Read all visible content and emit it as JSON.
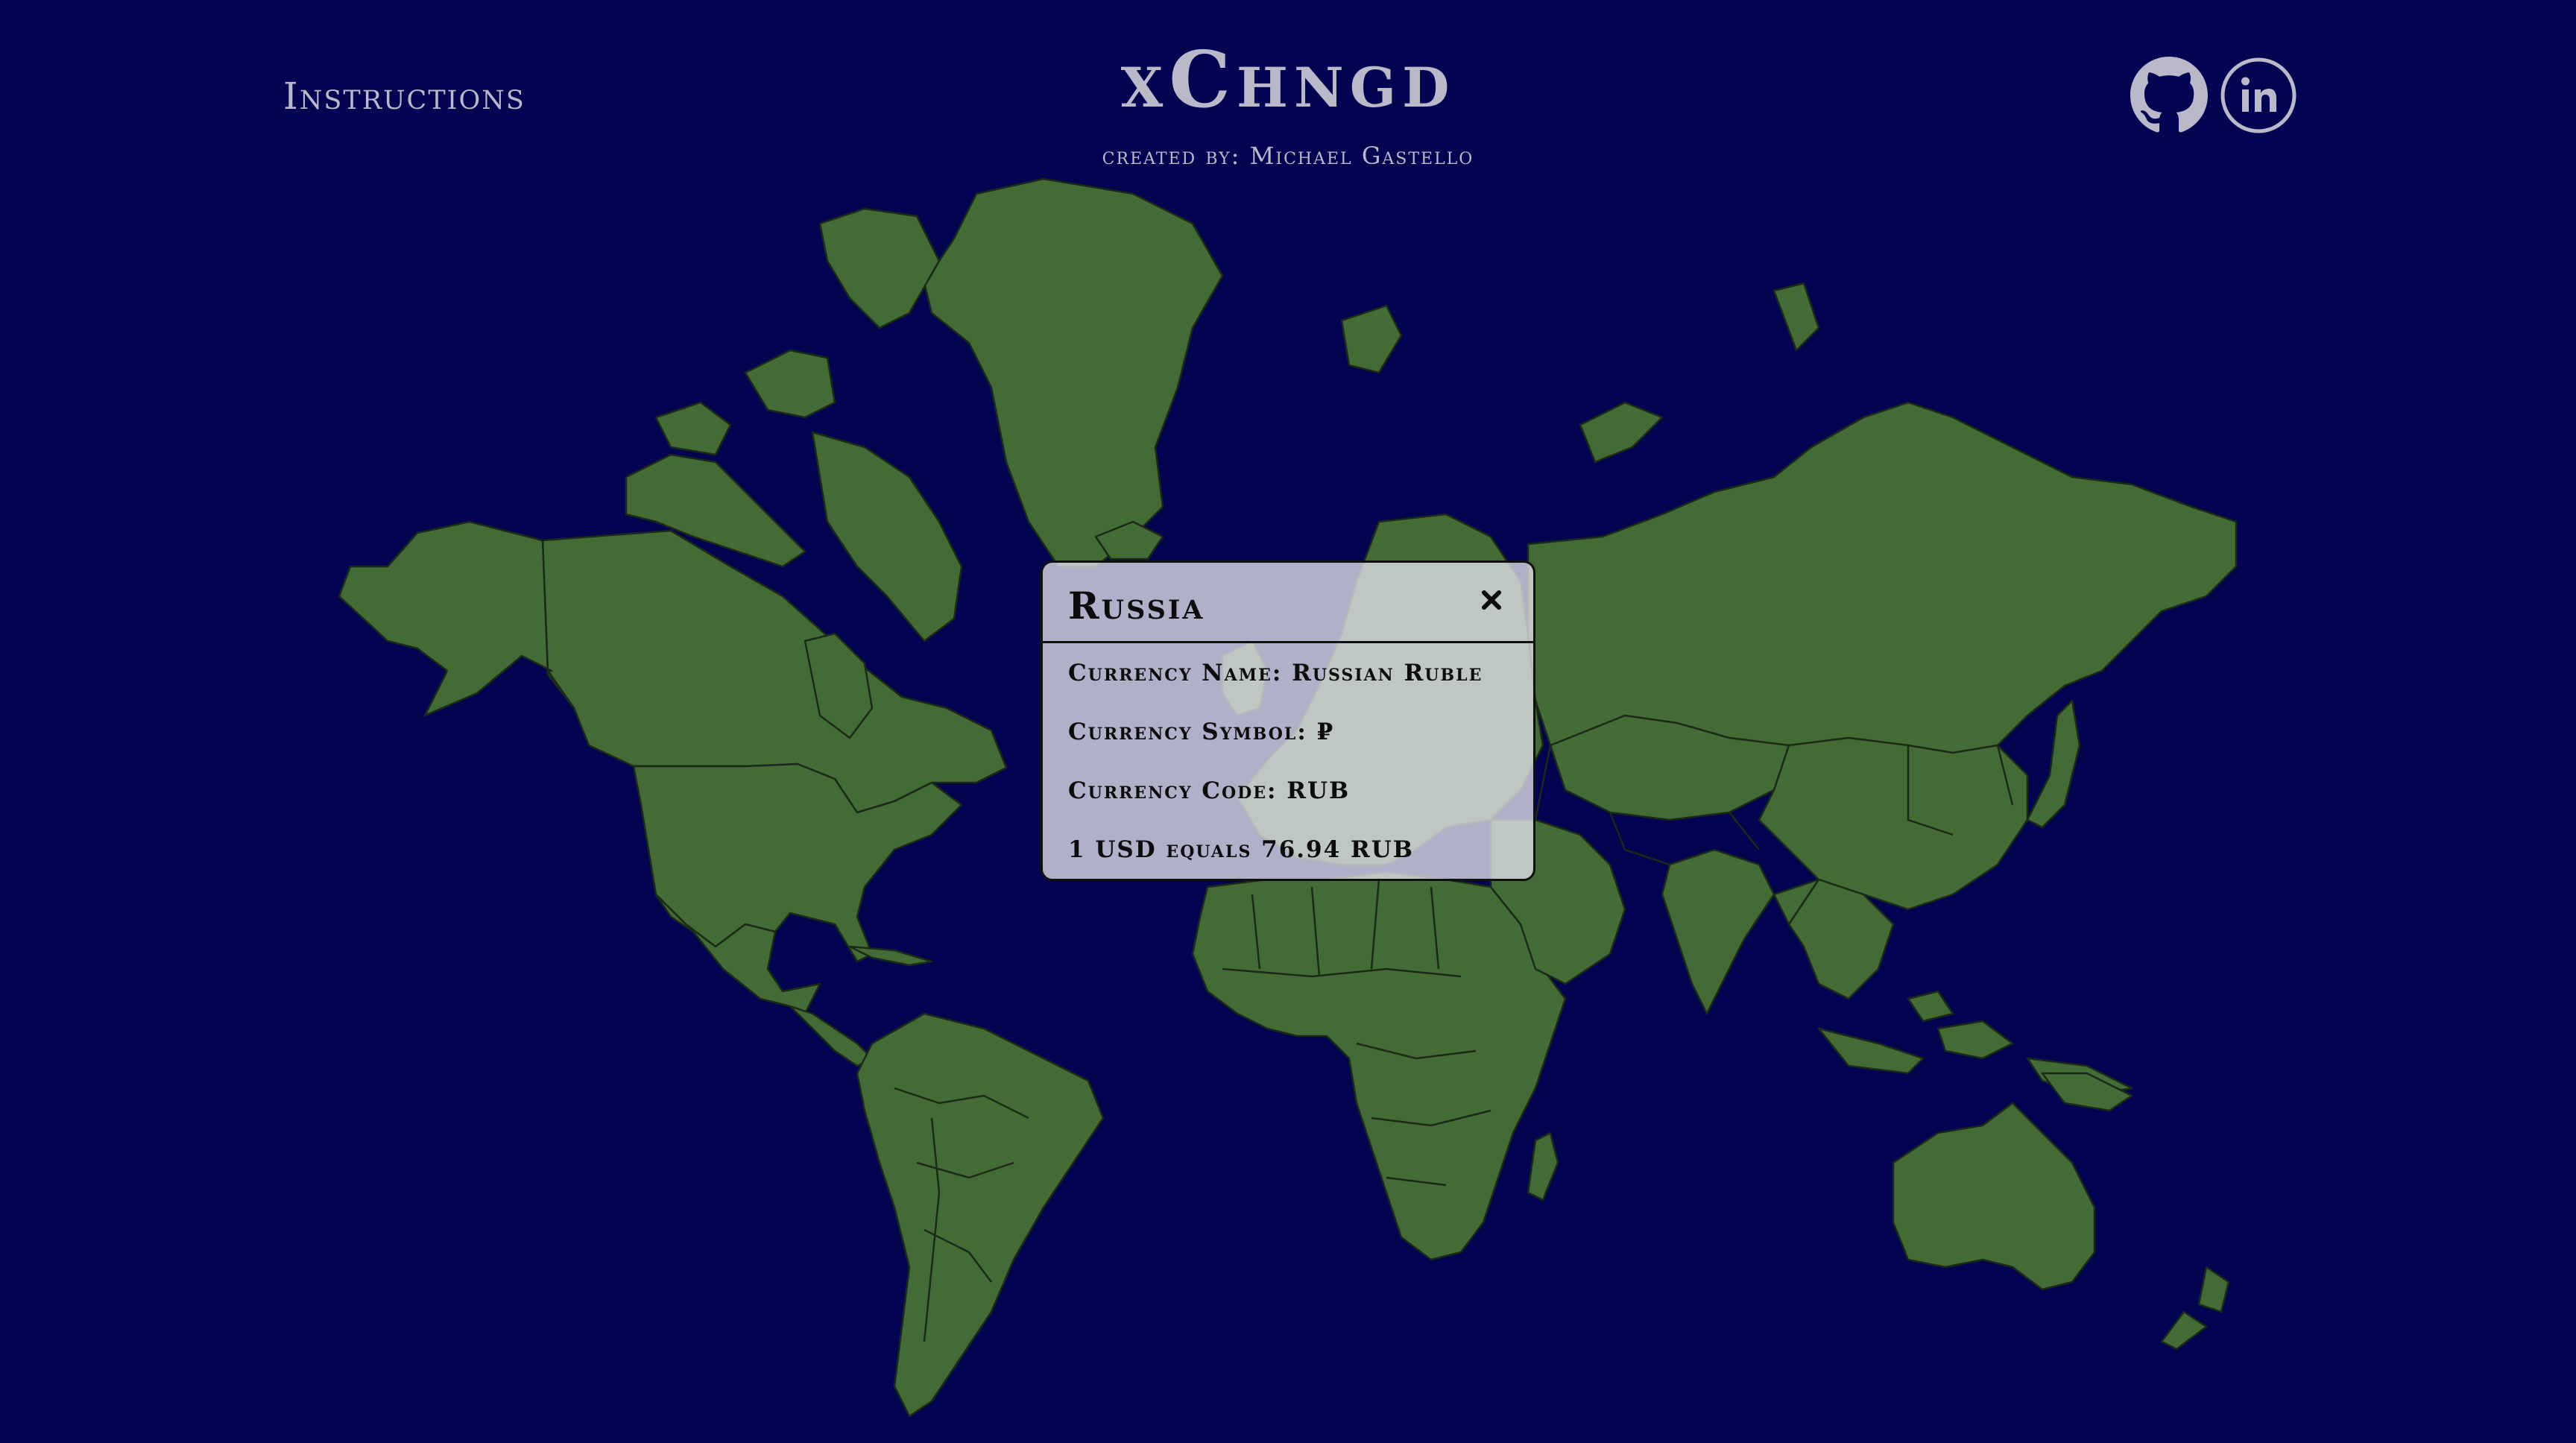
{
  "header": {
    "instructions_label": "Instructions",
    "title": "xChngd",
    "subtitle": "created by: Michael Gastello"
  },
  "social": {
    "github_icon": "github-icon",
    "linkedin_icon": "linkedin-icon",
    "linkedin_text": "in"
  },
  "popup": {
    "country": "Russia",
    "close_icon": "close-icon",
    "currency_name": "Currency Name: Russian Ruble",
    "currency_symbol": "Currency Symbol: ₽",
    "currency_code": "Currency Code: RUB",
    "exchange_rate": "1 USD equals 76.94 RUB"
  },
  "map": {
    "selected_country": "Russia"
  },
  "colors": {
    "ocean": "#020452",
    "land": "#436b35",
    "border": "#1b2a16",
    "text": "#b9b9c9",
    "popup_bg": "#e1e1eb"
  }
}
